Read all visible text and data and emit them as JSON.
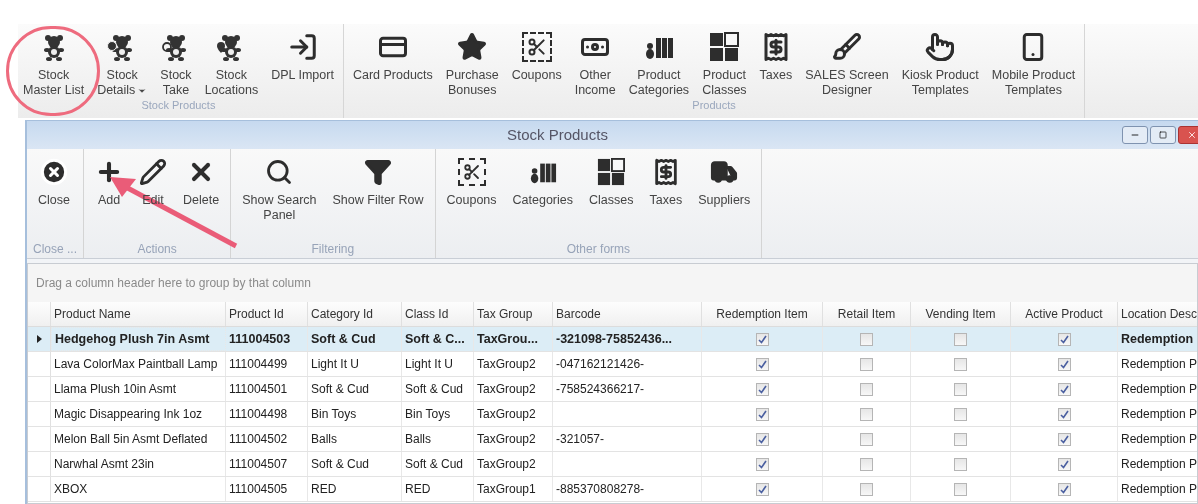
{
  "ribbon": {
    "groups": [
      {
        "label": "Stock Products",
        "buttons": [
          {
            "lines": [
              "Stock",
              "Master List"
            ],
            "dropdown": false,
            "highlighted": true
          },
          {
            "lines": [
              "Stock",
              "Details"
            ],
            "dropdown": true,
            "highlighted": false
          },
          {
            "lines": [
              "Stock",
              "Take"
            ],
            "dropdown": false,
            "highlighted": false
          },
          {
            "lines": [
              "Stock",
              "Locations"
            ],
            "dropdown": false,
            "highlighted": false
          },
          {
            "lines": [
              "DPL Import"
            ],
            "dropdown": false,
            "highlighted": false
          }
        ]
      },
      {
        "label": "Products",
        "buttons": [
          {
            "lines": [
              "Card Products"
            ],
            "dropdown": false,
            "highlighted": false
          },
          {
            "lines": [
              "Purchase",
              "Bonuses"
            ],
            "dropdown": false,
            "highlighted": false
          },
          {
            "lines": [
              "Coupons"
            ],
            "dropdown": false,
            "highlighted": false
          },
          {
            "lines": [
              "Other",
              "Income"
            ],
            "dropdown": false,
            "highlighted": false
          },
          {
            "lines": [
              "Product",
              "Categories"
            ],
            "dropdown": false,
            "highlighted": false
          },
          {
            "lines": [
              "Product",
              "Classes"
            ],
            "dropdown": false,
            "highlighted": false
          },
          {
            "lines": [
              "Taxes"
            ],
            "dropdown": false,
            "highlighted": false
          },
          {
            "lines": [
              "SALES Screen",
              "Designer"
            ],
            "dropdown": false,
            "highlighted": false
          },
          {
            "lines": [
              "Kiosk Product",
              "Templates"
            ],
            "dropdown": false,
            "highlighted": false
          },
          {
            "lines": [
              "Mobile Product",
              "Templates"
            ],
            "dropdown": false,
            "highlighted": false
          }
        ]
      }
    ]
  },
  "window": {
    "title": "Stock Products"
  },
  "toolbar": {
    "groups": [
      {
        "label": "Close ...",
        "buttons": [
          {
            "lines": [
              "Close"
            ],
            "pointed_at": false
          }
        ]
      },
      {
        "label": "Actions",
        "buttons": [
          {
            "lines": [
              "Add"
            ],
            "pointed_at": true
          },
          {
            "lines": [
              "Edit"
            ],
            "pointed_at": false
          },
          {
            "lines": [
              "Delete"
            ],
            "pointed_at": false
          }
        ]
      },
      {
        "label": "Filtering",
        "buttons": [
          {
            "lines": [
              "Show Search",
              "Panel"
            ],
            "pointed_at": false
          },
          {
            "lines": [
              "Show Filter Row"
            ],
            "pointed_at": false
          }
        ]
      },
      {
        "label": "Other forms",
        "buttons": [
          {
            "lines": [
              "Coupons"
            ],
            "pointed_at": false
          },
          {
            "lines": [
              "Categories"
            ],
            "pointed_at": false
          },
          {
            "lines": [
              "Classes"
            ],
            "pointed_at": false
          },
          {
            "lines": [
              "Taxes"
            ],
            "pointed_at": false
          },
          {
            "lines": [
              "Suppliers"
            ],
            "pointed_at": false
          }
        ]
      }
    ]
  },
  "grid": {
    "group_hint": "Drag a column header here to group by that column",
    "columns": [
      {
        "label": "Product Name",
        "kind": "text"
      },
      {
        "label": "Product Id",
        "kind": "text"
      },
      {
        "label": "Category Id",
        "kind": "text"
      },
      {
        "label": "Class Id",
        "kind": "text"
      },
      {
        "label": "Tax Group",
        "kind": "text"
      },
      {
        "label": "Barcode",
        "kind": "text"
      },
      {
        "label": "Redemption Item",
        "kind": "check"
      },
      {
        "label": "Retail Item",
        "kind": "check"
      },
      {
        "label": "Vending Item",
        "kind": "check"
      },
      {
        "label": "Active Product",
        "kind": "check"
      },
      {
        "label": "Location Desc",
        "kind": "text"
      }
    ],
    "rows": [
      {
        "selected": true,
        "product_name": "Hedgehog Plush 7in Asmt",
        "product_id": "111004503",
        "category_id": "Soft & Cud",
        "class_id": "Soft & C...",
        "tax_group": "TaxGrou...",
        "barcode": "-321098-75852436...",
        "redemption_item": true,
        "retail_item": false,
        "vending_item": false,
        "active_product": true,
        "location_desc": "Redemption"
      },
      {
        "selected": false,
        "product_name": "Lava ColorMax Paintball Lamp",
        "product_id": "111004499",
        "category_id": "Light It U",
        "class_id": "Light It U",
        "tax_group": "TaxGroup2",
        "barcode": "-047162121426-",
        "redemption_item": true,
        "retail_item": false,
        "vending_item": false,
        "active_product": true,
        "location_desc": "Redemption P"
      },
      {
        "selected": false,
        "product_name": "Llama Plush 10in Asmt",
        "product_id": "111004501",
        "category_id": "Soft & Cud",
        "class_id": "Soft & Cud",
        "tax_group": "TaxGroup2",
        "barcode": "-758524366217-",
        "redemption_item": true,
        "retail_item": false,
        "vending_item": false,
        "active_product": true,
        "location_desc": "Redemption P"
      },
      {
        "selected": false,
        "product_name": "Magic Disappearing Ink 1oz",
        "product_id": "111004498",
        "category_id": "Bin Toys",
        "class_id": "Bin Toys",
        "tax_group": "TaxGroup2",
        "redemption_item": true,
        "retail_item": false,
        "vending_item": false,
        "active_product": true,
        "location_desc": "Redemption P"
      },
      {
        "selected": false,
        "product_name": "Melon Ball 5in Asmt Deflated",
        "product_id": "111004502",
        "category_id": "Balls",
        "class_id": "Balls",
        "tax_group": "TaxGroup2",
        "barcode": "-321057-",
        "redemption_item": true,
        "retail_item": false,
        "vending_item": false,
        "active_product": true,
        "location_desc": "Redemption P"
      },
      {
        "selected": false,
        "product_name": "Narwhal Asmt 23in",
        "product_id": "111004507",
        "category_id": "Soft & Cud",
        "class_id": "Soft & Cud",
        "tax_group": "TaxGroup2",
        "redemption_item": true,
        "retail_item": false,
        "vending_item": false,
        "active_product": true,
        "location_desc": "Redemption P"
      },
      {
        "selected": false,
        "product_name": "XBOX",
        "product_id": "111004505",
        "category_id": "RED",
        "class_id": "RED",
        "tax_group": "TaxGroup1",
        "barcode": "-885370808278-",
        "redemption_item": true,
        "retail_item": false,
        "vending_item": false,
        "active_product": true,
        "location_desc": "Redemption P"
      }
    ]
  }
}
